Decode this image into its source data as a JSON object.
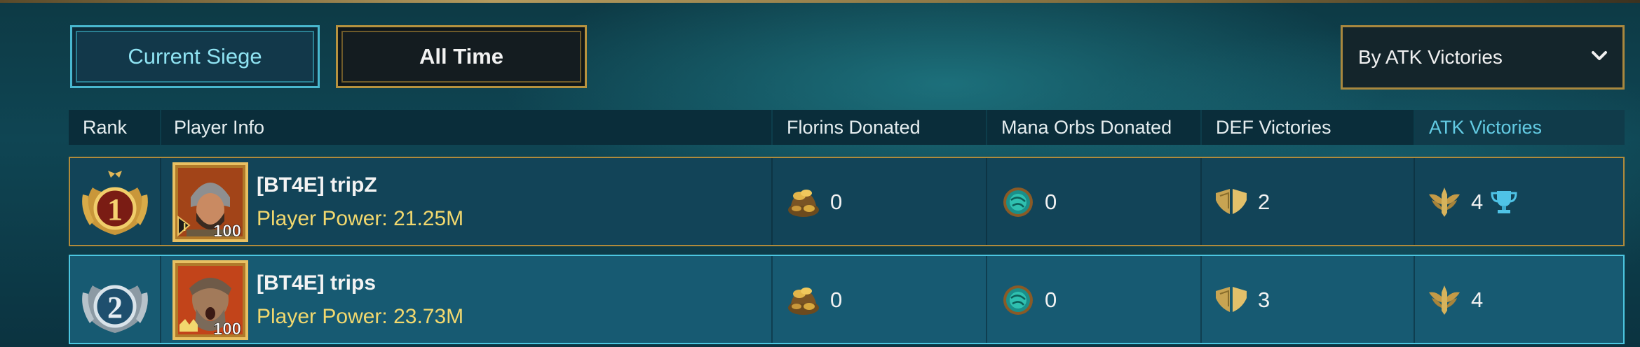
{
  "tabs": {
    "current_siege": "Current Siege",
    "all_time": "All Time"
  },
  "sort_dropdown": {
    "selected": "By ATK Victories",
    "icon": "chevron-down-icon"
  },
  "table": {
    "headers": {
      "rank": "Rank",
      "player_info": "Player Info",
      "florins": "Florins Donated",
      "mana_orbs": "Mana Orbs Donated",
      "def_victories": "DEF Victories",
      "atk_victories": "ATK Victories"
    },
    "active_column": "atk_victories",
    "rows": [
      {
        "rank": "1",
        "name": "[BT4E] tripZ",
        "power": "Player Power: 21.25M",
        "level": "100",
        "rank_pip": "I",
        "florins": "0",
        "mana_orbs": "0",
        "def_victories": "2",
        "atk_victories": "4",
        "trophy": true
      },
      {
        "rank": "2",
        "name": "[BT4E] trips",
        "power": "Player Power: 23.73M",
        "level": "100",
        "rank_pip": "crown",
        "florins": "0",
        "mana_orbs": "0",
        "def_victories": "3",
        "atk_victories": "4",
        "trophy": false
      }
    ]
  },
  "colors": {
    "active_header": "#63cbe3",
    "gold_border": "#b08b3b",
    "cyan_border": "#4cc6e0",
    "power_text": "#f2d86e"
  }
}
